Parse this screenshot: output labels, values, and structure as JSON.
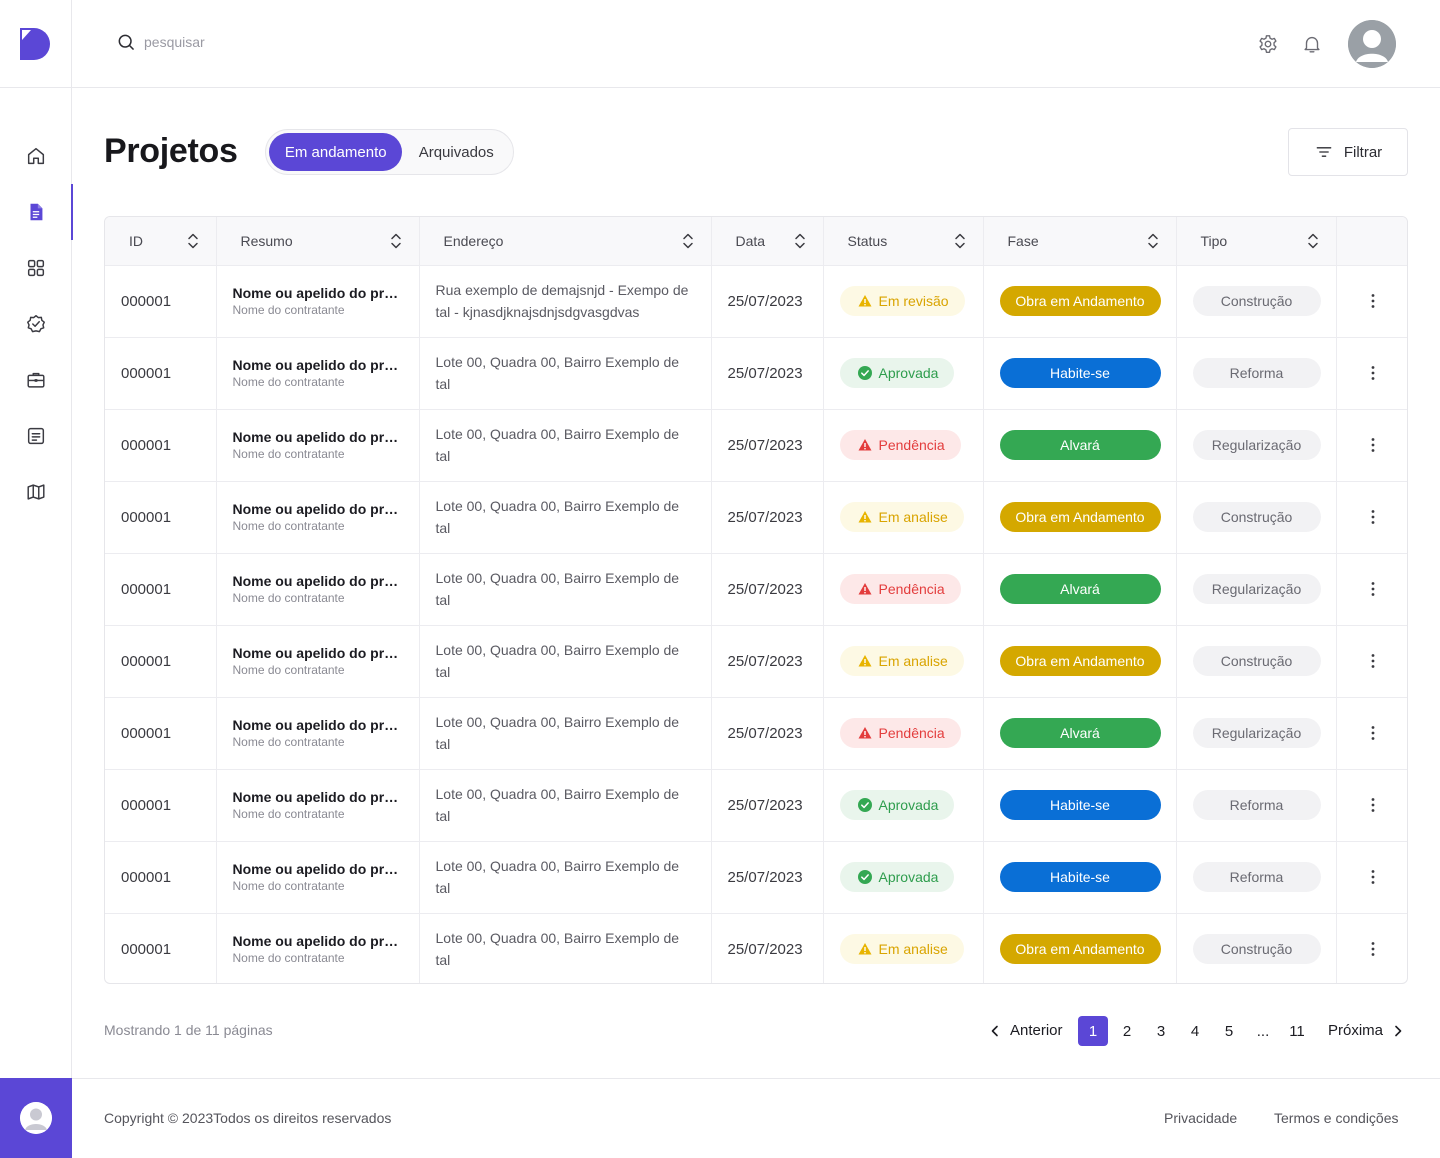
{
  "search": {
    "placeholder": "pesquisar"
  },
  "page": {
    "title": "Projetos"
  },
  "tabs": [
    {
      "label": "Em andamento",
      "active": true
    },
    {
      "label": "Arquivados",
      "active": false
    }
  ],
  "filter": {
    "label": "Filtrar"
  },
  "colors": {
    "accent": "#5b47d6",
    "fase_obra": "#d4a800",
    "fase_habite": "#0a6fd6",
    "fase_alvara": "#34a853"
  },
  "table": {
    "headers": [
      "ID",
      "Resumo",
      "Endereço",
      "Data",
      "Status",
      "Fase",
      "Tipo"
    ],
    "rows": [
      {
        "id": "000001",
        "title": "Nome ou apelido do pro...",
        "sub": "Nome do contratante",
        "address": "Rua exemplo de demajsnjd - Exempo de tal - kjnasdjknajsdnjsdgvasgdvas",
        "date": "25/07/2023",
        "status": "Em revisão",
        "status_kind": "warn",
        "fase": "Obra em Andamento",
        "fase_kind": "obra",
        "tipo": "Construção"
      },
      {
        "id": "000001",
        "title": "Nome ou apelido do pro...",
        "sub": "Nome do contratante",
        "address": "Lote 00, Quadra 00, Bairro Exemplo de tal",
        "date": "25/07/2023",
        "status": "Aprovada",
        "status_kind": "ok",
        "fase": "Habite-se",
        "fase_kind": "habite",
        "tipo": "Reforma"
      },
      {
        "id": "000001",
        "title": "Nome ou apelido do pro...",
        "sub": "Nome do contratante",
        "address": "Lote 00, Quadra 00, Bairro Exemplo de tal",
        "date": "25/07/2023",
        "status": "Pendência",
        "status_kind": "err",
        "fase": "Alvará",
        "fase_kind": "alvara",
        "tipo": "Regularização"
      },
      {
        "id": "000001",
        "title": "Nome ou apelido do pro...",
        "sub": "Nome do contratante",
        "address": "Lote 00, Quadra 00, Bairro Exemplo de tal",
        "date": "25/07/2023",
        "status": "Em analise",
        "status_kind": "warn",
        "fase": "Obra em Andamento",
        "fase_kind": "obra",
        "tipo": "Construção"
      },
      {
        "id": "000001",
        "title": "Nome ou apelido do pro...",
        "sub": "Nome do contratante",
        "address": "Lote 00, Quadra 00, Bairro Exemplo de tal",
        "date": "25/07/2023",
        "status": "Pendência",
        "status_kind": "err",
        "fase": "Alvará",
        "fase_kind": "alvara",
        "tipo": "Regularização"
      },
      {
        "id": "000001",
        "title": "Nome ou apelido do pro...",
        "sub": "Nome do contratante",
        "address": "Lote 00, Quadra 00, Bairro Exemplo de tal",
        "date": "25/07/2023",
        "status": "Em analise",
        "status_kind": "warn",
        "fase": "Obra em Andamento",
        "fase_kind": "obra",
        "tipo": "Construção"
      },
      {
        "id": "000001",
        "title": "Nome ou apelido do pro...",
        "sub": "Nome do contratante",
        "address": "Lote 00, Quadra 00, Bairro Exemplo de tal",
        "date": "25/07/2023",
        "status": "Pendência",
        "status_kind": "err",
        "fase": "Alvará",
        "fase_kind": "alvara",
        "tipo": "Regularização"
      },
      {
        "id": "000001",
        "title": "Nome ou apelido do pro...",
        "sub": "Nome do contratante",
        "address": "Lote 00, Quadra 00, Bairro Exemplo de tal",
        "date": "25/07/2023",
        "status": "Aprovada",
        "status_kind": "ok",
        "fase": "Habite-se",
        "fase_kind": "habite",
        "tipo": "Reforma"
      },
      {
        "id": "000001",
        "title": "Nome ou apelido do pro...",
        "sub": "Nome do contratante",
        "address": "Lote 00, Quadra 00, Bairro Exemplo de tal",
        "date": "25/07/2023",
        "status": "Aprovada",
        "status_kind": "ok",
        "fase": "Habite-se",
        "fase_kind": "habite",
        "tipo": "Reforma"
      },
      {
        "id": "000001",
        "title": "Nome ou apelido do pro...",
        "sub": "Nome do contratante",
        "address": "Lote 00, Quadra 00, Bairro Exemplo de tal",
        "date": "25/07/2023",
        "status": "Em analise",
        "status_kind": "warn",
        "fase": "Obra em Andamento",
        "fase_kind": "obra",
        "tipo": "Construção"
      }
    ]
  },
  "pagination": {
    "showing": "Mostrando 1 de 11 páginas",
    "prev": "Anterior",
    "next": "Próxima",
    "pages": [
      "1",
      "2",
      "3",
      "4",
      "5",
      "...",
      "11"
    ],
    "current": "1"
  },
  "footer": {
    "copyright": "Copyright © 2023Todos os direitos reservados",
    "privacy": "Privacidade",
    "terms": "Termos e condições"
  }
}
